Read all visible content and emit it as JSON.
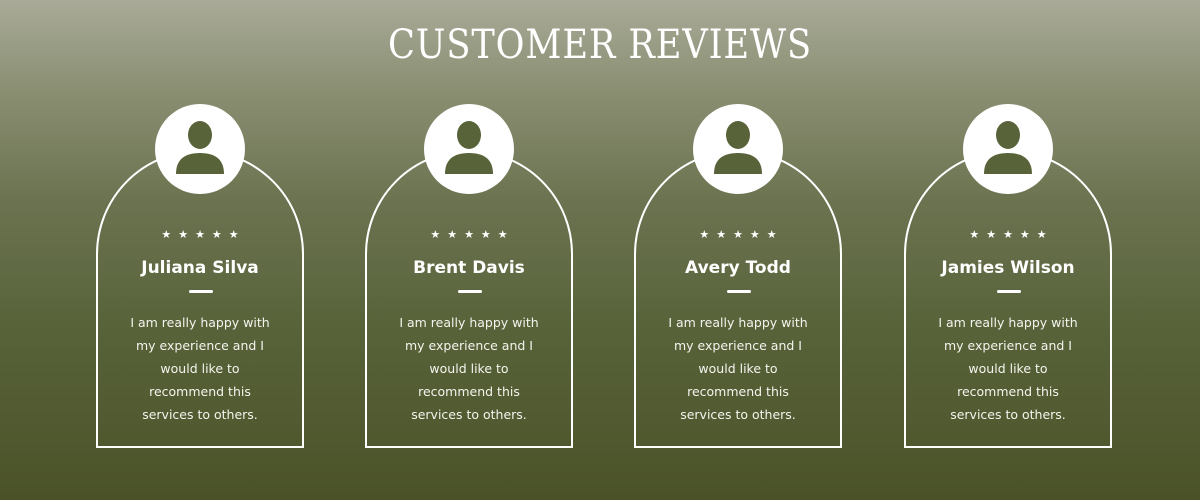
{
  "title": "CUSTOMER REVIEWS",
  "reviews": [
    {
      "name": "Juliana Silva",
      "stars": "★★★★★",
      "text": "I am really happy with my experience and I would like to recommend this services to others.",
      "rating": 5,
      "avatar_icon": "user-icon"
    },
    {
      "name": "Brent Davis",
      "stars": "★★★★★",
      "text": "I am really happy with my experience and I would like to recommend this services to others.",
      "rating": 5,
      "avatar_icon": "user-icon"
    },
    {
      "name": "Avery Todd",
      "stars": "★★★★★",
      "text": "I am really happy with my experience and I would like to recommend this services to others.",
      "rating": 5,
      "avatar_icon": "user-icon"
    },
    {
      "name": "Jamies Wilson",
      "stars": "★★★★★",
      "text": "I am really happy with my experience and I would like to recommend this services to others.",
      "rating": 5,
      "avatar_icon": "user-icon"
    }
  ],
  "colors": {
    "background_top": "#a9aa98",
    "background_bottom": "#4b5228",
    "foreground": "#ffffff",
    "avatar_icon": "#58633a"
  }
}
